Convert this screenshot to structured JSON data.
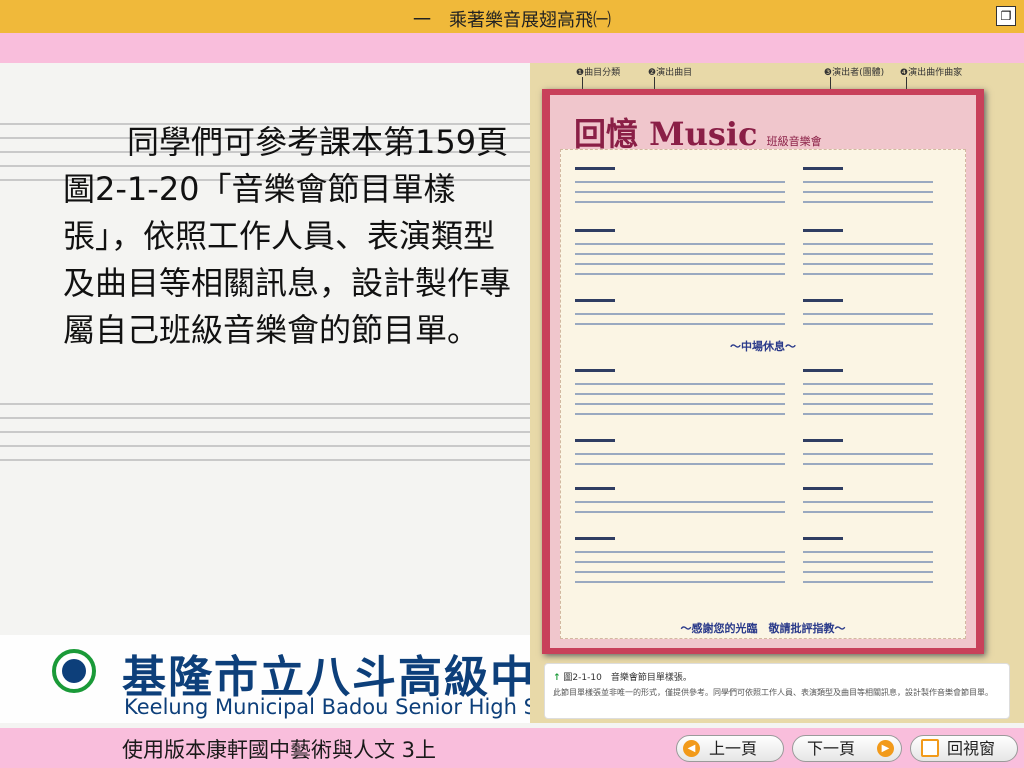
{
  "header": {
    "title": "一　乘著樂音展翅高飛㈠",
    "window_icon": "window-restore-icon"
  },
  "body": {
    "paragraph": "同學們可參考課本第159頁圖2-1-20「音樂會節目單樣張」，依照工作人員、表演類型及曲目等相關訊息，設計製作專屬自己班級音樂會的節目單。"
  },
  "school": {
    "name_zh": "基隆市立八斗高級中",
    "name_en": "Keelung Municipal Badou Senior High Sc"
  },
  "figure": {
    "annotations": [
      "❶曲目分類",
      "❷演出曲目",
      "❸演出者(團體)",
      "❹演出曲作曲家"
    ],
    "header_big": "回憶 Music",
    "header_small": "班級音樂會",
    "intermission": "～中場休息～",
    "thanks": "～感謝您的光臨　敬請批評指教～",
    "caption_title": "圖2-1-10　音樂會節目單樣張。",
    "caption_body": "此節目單樣張並非唯一的形式，僅提供參考。同學們可依照工作人員、表演類型及曲目等相關訊息，設計製作音樂會節目單。"
  },
  "footer": {
    "text": "使用版本康軒國中藝術與人文 3上",
    "prev_label": "上一頁",
    "next_label": "下一頁",
    "window_label": "回視窗"
  },
  "colors": {
    "title_bar": "#f0b93a",
    "pink": "#f9bedc",
    "school_blue": "#0d3f7a",
    "accent_orange": "#f29a1a"
  }
}
